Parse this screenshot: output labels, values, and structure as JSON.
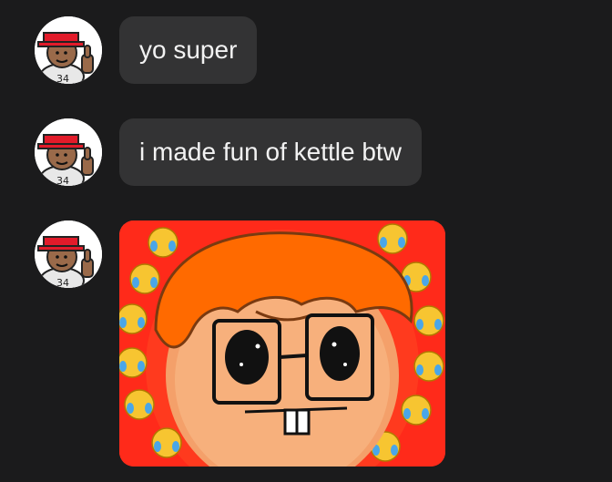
{
  "messages": [
    {
      "type": "text",
      "text": "yo super",
      "avatar_icon": "thumbs-up-character-icon"
    },
    {
      "type": "text",
      "text": "i made fun of kettle btw",
      "avatar_icon": "thumbs-up-character-icon"
    },
    {
      "type": "image",
      "image_subject": "orange-haired-cartoon-face-with-laughing-emoji-ring",
      "avatar_icon": "thumbs-up-character-icon"
    }
  ],
  "avatar": {
    "jersey_number": "34"
  },
  "colors": {
    "background": "#1b1b1c",
    "bubble": "#333334",
    "text": "#f2f2f2",
    "hat": "#e21b2a",
    "emoji_ring": "#ff2a1a",
    "hair": "#ff6a00"
  }
}
